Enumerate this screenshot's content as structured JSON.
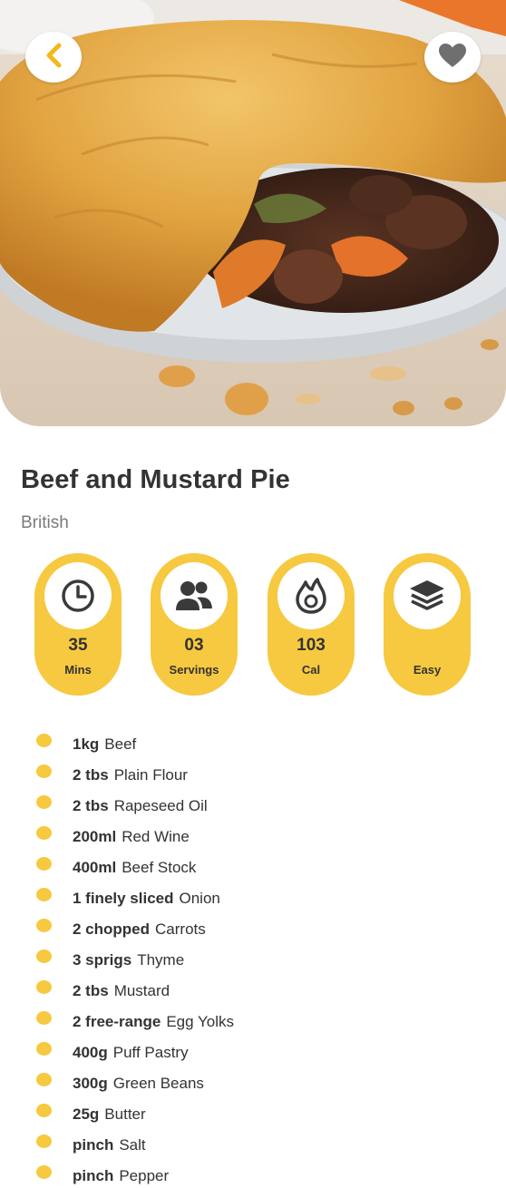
{
  "recipe": {
    "title": "Beef and Mustard Pie",
    "cuisine": "British"
  },
  "stats": [
    {
      "icon": "clock-icon",
      "value": "35",
      "unit": "Mins"
    },
    {
      "icon": "people-icon",
      "value": "03",
      "unit": "Servings"
    },
    {
      "icon": "flame-icon",
      "value": "103",
      "unit": "Cal"
    },
    {
      "icon": "layers-icon",
      "value": "",
      "unit": "Easy"
    }
  ],
  "ingredients": [
    {
      "qty": "1kg",
      "name": "Beef"
    },
    {
      "qty": "2 tbs",
      "name": "Plain Flour"
    },
    {
      "qty": "2 tbs",
      "name": "Rapeseed Oil"
    },
    {
      "qty": "200ml",
      "name": "Red Wine"
    },
    {
      "qty": "400ml",
      "name": "Beef Stock"
    },
    {
      "qty": "1 finely sliced",
      "name": "Onion"
    },
    {
      "qty": "2 chopped",
      "name": "Carrots"
    },
    {
      "qty": "3 sprigs",
      "name": "Thyme"
    },
    {
      "qty": "2 tbs",
      "name": "Mustard"
    },
    {
      "qty": "2 free-range",
      "name": "Egg Yolks"
    },
    {
      "qty": "400g",
      "name": "Puff Pastry"
    },
    {
      "qty": "300g",
      "name": "Green Beans"
    },
    {
      "qty": "25g",
      "name": "Butter"
    },
    {
      "qty": "pinch",
      "name": "Salt"
    },
    {
      "qty": "pinch",
      "name": "Pepper"
    }
  ],
  "colors": {
    "accent": "#f6c940",
    "back_arrow": "#f3b91b",
    "heart": "#6f6f6f",
    "text": "#333333",
    "subtext": "#7a7a7a"
  },
  "icons": {
    "back": "chevron-left-icon",
    "favorite": "heart-icon"
  }
}
